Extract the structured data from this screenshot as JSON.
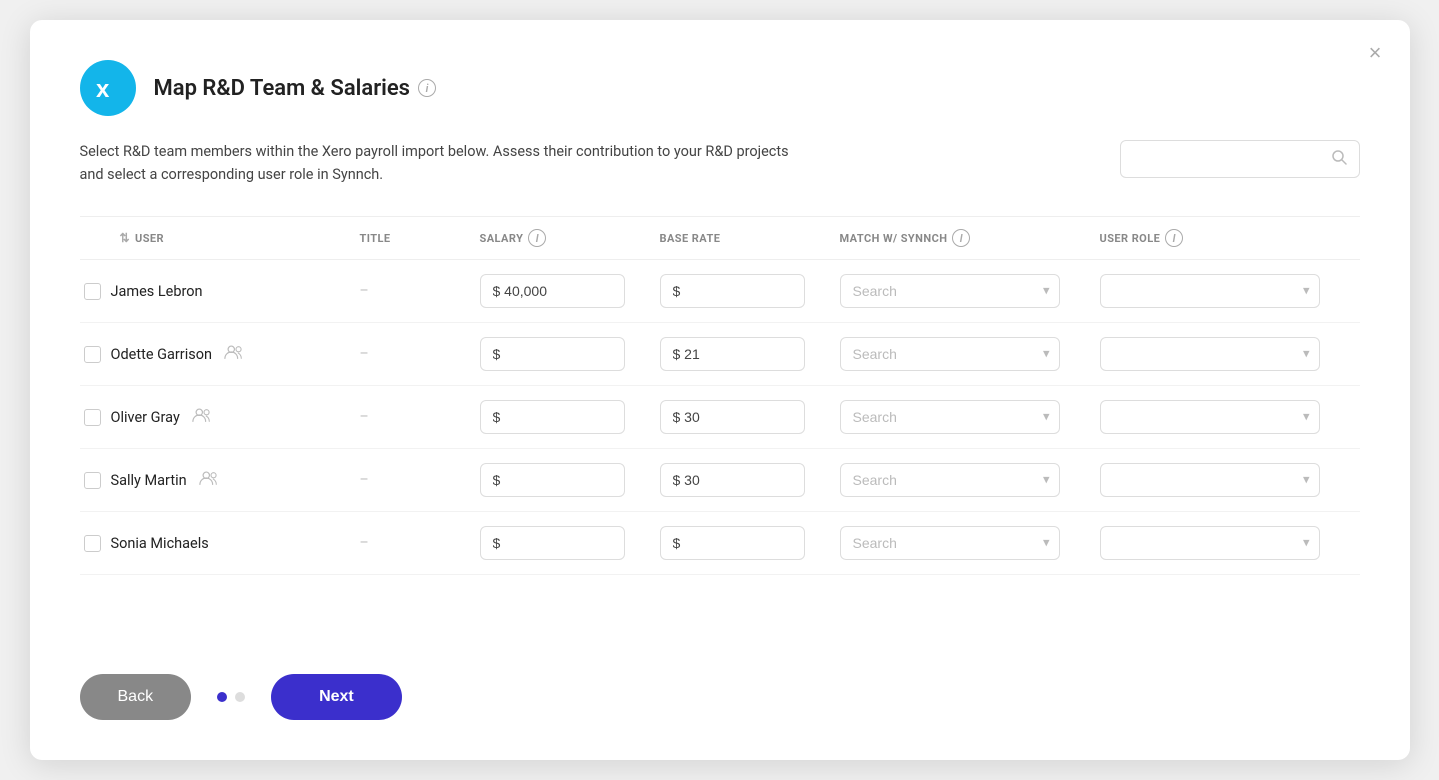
{
  "modal": {
    "title": "Map R&D Team & Salaries",
    "close_label": "×",
    "description": "Select R&D team members within the Xero payroll import below. Assess their contribution to your R&D projects and select a corresponding user role in Synnch.",
    "search_placeholder": ""
  },
  "table": {
    "headers": [
      {
        "id": "user",
        "label": "USER",
        "sortable": true
      },
      {
        "id": "title",
        "label": "TITLE",
        "sortable": false
      },
      {
        "id": "salary",
        "label": "SALARY",
        "info": true,
        "sortable": false
      },
      {
        "id": "base_rate",
        "label": "BASE RATE",
        "sortable": false
      },
      {
        "id": "match_synnch",
        "label": "MATCH W/ SYNNCH",
        "info": true,
        "sortable": false
      },
      {
        "id": "user_role",
        "label": "USER ROLE",
        "info": true,
        "sortable": false
      }
    ],
    "rows": [
      {
        "id": 1,
        "name": "James Lebron",
        "has_user_icon": false,
        "title": "–",
        "salary": "$ 40,000",
        "base_rate": "$",
        "match_search": "Search",
        "user_role": ""
      },
      {
        "id": 2,
        "name": "Odette Garrison",
        "has_user_icon": true,
        "title": "–",
        "salary": "$",
        "base_rate": "$ 21",
        "match_search": "Search",
        "user_role": ""
      },
      {
        "id": 3,
        "name": "Oliver Gray",
        "has_user_icon": true,
        "title": "–",
        "salary": "$",
        "base_rate": "$ 30",
        "match_search": "Search",
        "user_role": ""
      },
      {
        "id": 4,
        "name": "Sally Martin",
        "has_user_icon": true,
        "title": "–",
        "salary": "$",
        "base_rate": "$ 30",
        "match_search": "Search",
        "user_role": ""
      },
      {
        "id": 5,
        "name": "Sonia Michaels",
        "has_user_icon": false,
        "title": "–",
        "salary": "$",
        "base_rate": "$",
        "match_search": "Search",
        "user_role": ""
      }
    ]
  },
  "footer": {
    "back_label": "Back",
    "next_label": "Next",
    "dots": [
      {
        "active": true
      },
      {
        "active": false
      }
    ]
  }
}
